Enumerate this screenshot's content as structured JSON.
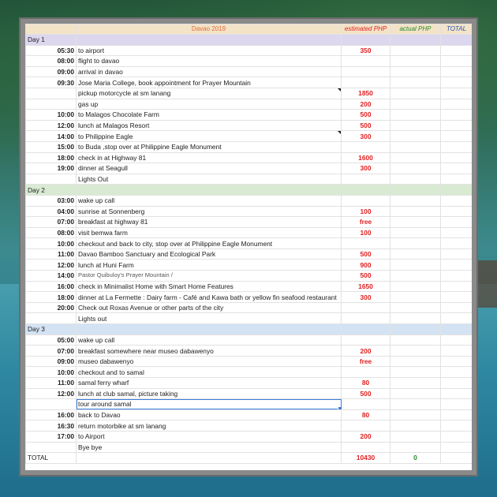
{
  "header": {
    "title": "Davao 2019",
    "estimated": "estimated PHP",
    "actual": "actual PHP",
    "total": "TOTAL"
  },
  "days": [
    {
      "label": "Day 1",
      "rows": [
        {
          "time": "05:30",
          "activity": "to airport",
          "est": "350"
        },
        {
          "time": "08:00",
          "activity": "flight to davao",
          "est": ""
        },
        {
          "time": "09:00",
          "activity": "arrival in davao",
          "est": ""
        },
        {
          "time": "09:30",
          "activity": "Jose Maria College, book appointment for Prayer Mountain",
          "est": ""
        },
        {
          "time": "",
          "activity": "pickup motorcycle at sm lanang",
          "est": "1850"
        },
        {
          "time": "",
          "activity": "gas up",
          "est": "200"
        },
        {
          "time": "10:00",
          "activity": "to Malagos Chocolate Farm",
          "est": "500"
        },
        {
          "time": "12:00",
          "activity": "lunch at Malagos Resort",
          "est": "500"
        },
        {
          "time": "14:00",
          "activity": "to Philippine Eagle",
          "est": "300"
        },
        {
          "time": "15:00",
          "activity": "to Buda ,stop over at Philippine Eagle Monument",
          "est": ""
        },
        {
          "time": "18:00",
          "activity": "check in at Highway 81",
          "est": "1600"
        },
        {
          "time": "19:00",
          "activity": "dinner at Seagull",
          "est": "300"
        },
        {
          "time": "",
          "activity": "Lights Out",
          "est": ""
        }
      ]
    },
    {
      "label": "Day 2",
      "rows": [
        {
          "time": "03:00",
          "activity": "wake up call",
          "est": ""
        },
        {
          "time": "04:00",
          "activity": "sunrise at Sonnenberg",
          "est": "100"
        },
        {
          "time": "07:00",
          "activity": "breakfast at highway 81",
          "est": "free"
        },
        {
          "time": "08:00",
          "activity": "visit bemwa farm",
          "est": "100"
        },
        {
          "time": "10:00",
          "activity": "checkout and back to city, stop over at Philippine Eagle Monument",
          "est": ""
        },
        {
          "time": "11:00",
          "activity": "Davao Bamboo Sanctuary and Ecological Park",
          "est": "500"
        },
        {
          "time": "12:00",
          "activity": "lunch at Huni Farm",
          "est": "900"
        },
        {
          "time": "14:00",
          "activity": "Pastor Quibuloy's Prayer Mountain /",
          "est": "500"
        },
        {
          "time": "16:00",
          "activity": "check  in Minimalist Home with Smart Home Features",
          "est": "1650"
        },
        {
          "time": "18:00",
          "activity": "dinner at La Fermette : Dairy farm - Café and Kawa bath or yellow fin seafood restaurant",
          "est": "300"
        },
        {
          "time": "20:00",
          "activity": "Check out Roxas Avenue or other parts of the city",
          "est": ""
        },
        {
          "time": "",
          "activity": "Lights out",
          "est": ""
        }
      ]
    },
    {
      "label": "Day 3",
      "rows": [
        {
          "time": "05:00",
          "activity": "wake up call",
          "est": ""
        },
        {
          "time": "07:00",
          "activity": "breakfast somewhere near museo dabawenyo",
          "est": "200"
        },
        {
          "time": "09:00",
          "activity": "museo dabawenyo",
          "est": "free"
        },
        {
          "time": "10:00",
          "activity": "checkout and to samal",
          "est": ""
        },
        {
          "time": "11:00",
          "activity": "samal ferry wharf",
          "est": "80"
        },
        {
          "time": "12:00",
          "activity": "lunch at club samal, picture taking",
          "est": "500"
        },
        {
          "time": "",
          "activity": "tour around samal",
          "est": ""
        },
        {
          "time": "16:00",
          "activity": "back to Davao",
          "est": "80"
        },
        {
          "time": "16:30",
          "activity": "return motorbike at sm lanang",
          "est": ""
        },
        {
          "time": "17:00",
          "activity": "to Airport",
          "est": "200"
        },
        {
          "time": "",
          "activity": "Bye bye",
          "est": ""
        }
      ]
    }
  ],
  "total_row": {
    "label": "TOTAL",
    "est": "10430",
    "actual": "0"
  },
  "colors": {
    "day1": "#dcd6ef",
    "day2": "#d9ead3",
    "day3": "#d3e3f3",
    "estimate_text": "#e02020",
    "actual_text": "#2a8a2a",
    "total_header": "#2a55b8"
  }
}
